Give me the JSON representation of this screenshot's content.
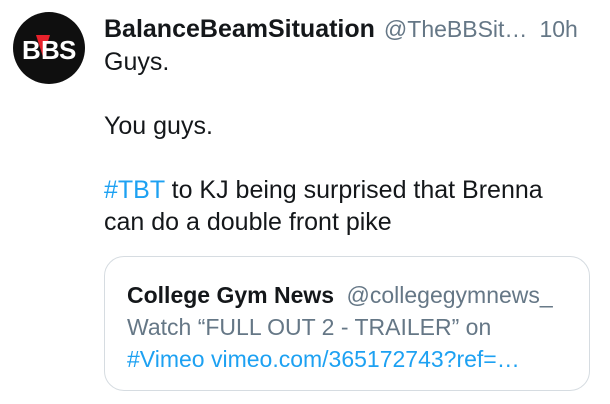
{
  "tweet": {
    "avatar": {
      "logo_text": "BBS",
      "colors": {
        "background": "#0f0f0f",
        "accent": "#e8212b",
        "text": "#ffffff"
      }
    },
    "display_name": "BalanceBeamSituation",
    "handle": "@TheBBSit…",
    "time": "10h",
    "lines": {
      "line1": "Guys.",
      "line2": "You guys.",
      "hashtag": "#TBT",
      "line3_rest": " to KJ being surprised that Brenna",
      "line4": "can do a double front pike"
    }
  },
  "quoted": {
    "display_name": "College Gym News",
    "handle": "@collegegymnews_",
    "text_line1": "Watch “FULL OUT 2 - TRAILER” on",
    "hashtag": "#Vimeo",
    "link": "vimeo.com/365172743?ref=…"
  },
  "colors": {
    "text": "#14171a",
    "muted": "#657786",
    "link": "#1da1f2",
    "border": "#d6dce1"
  }
}
